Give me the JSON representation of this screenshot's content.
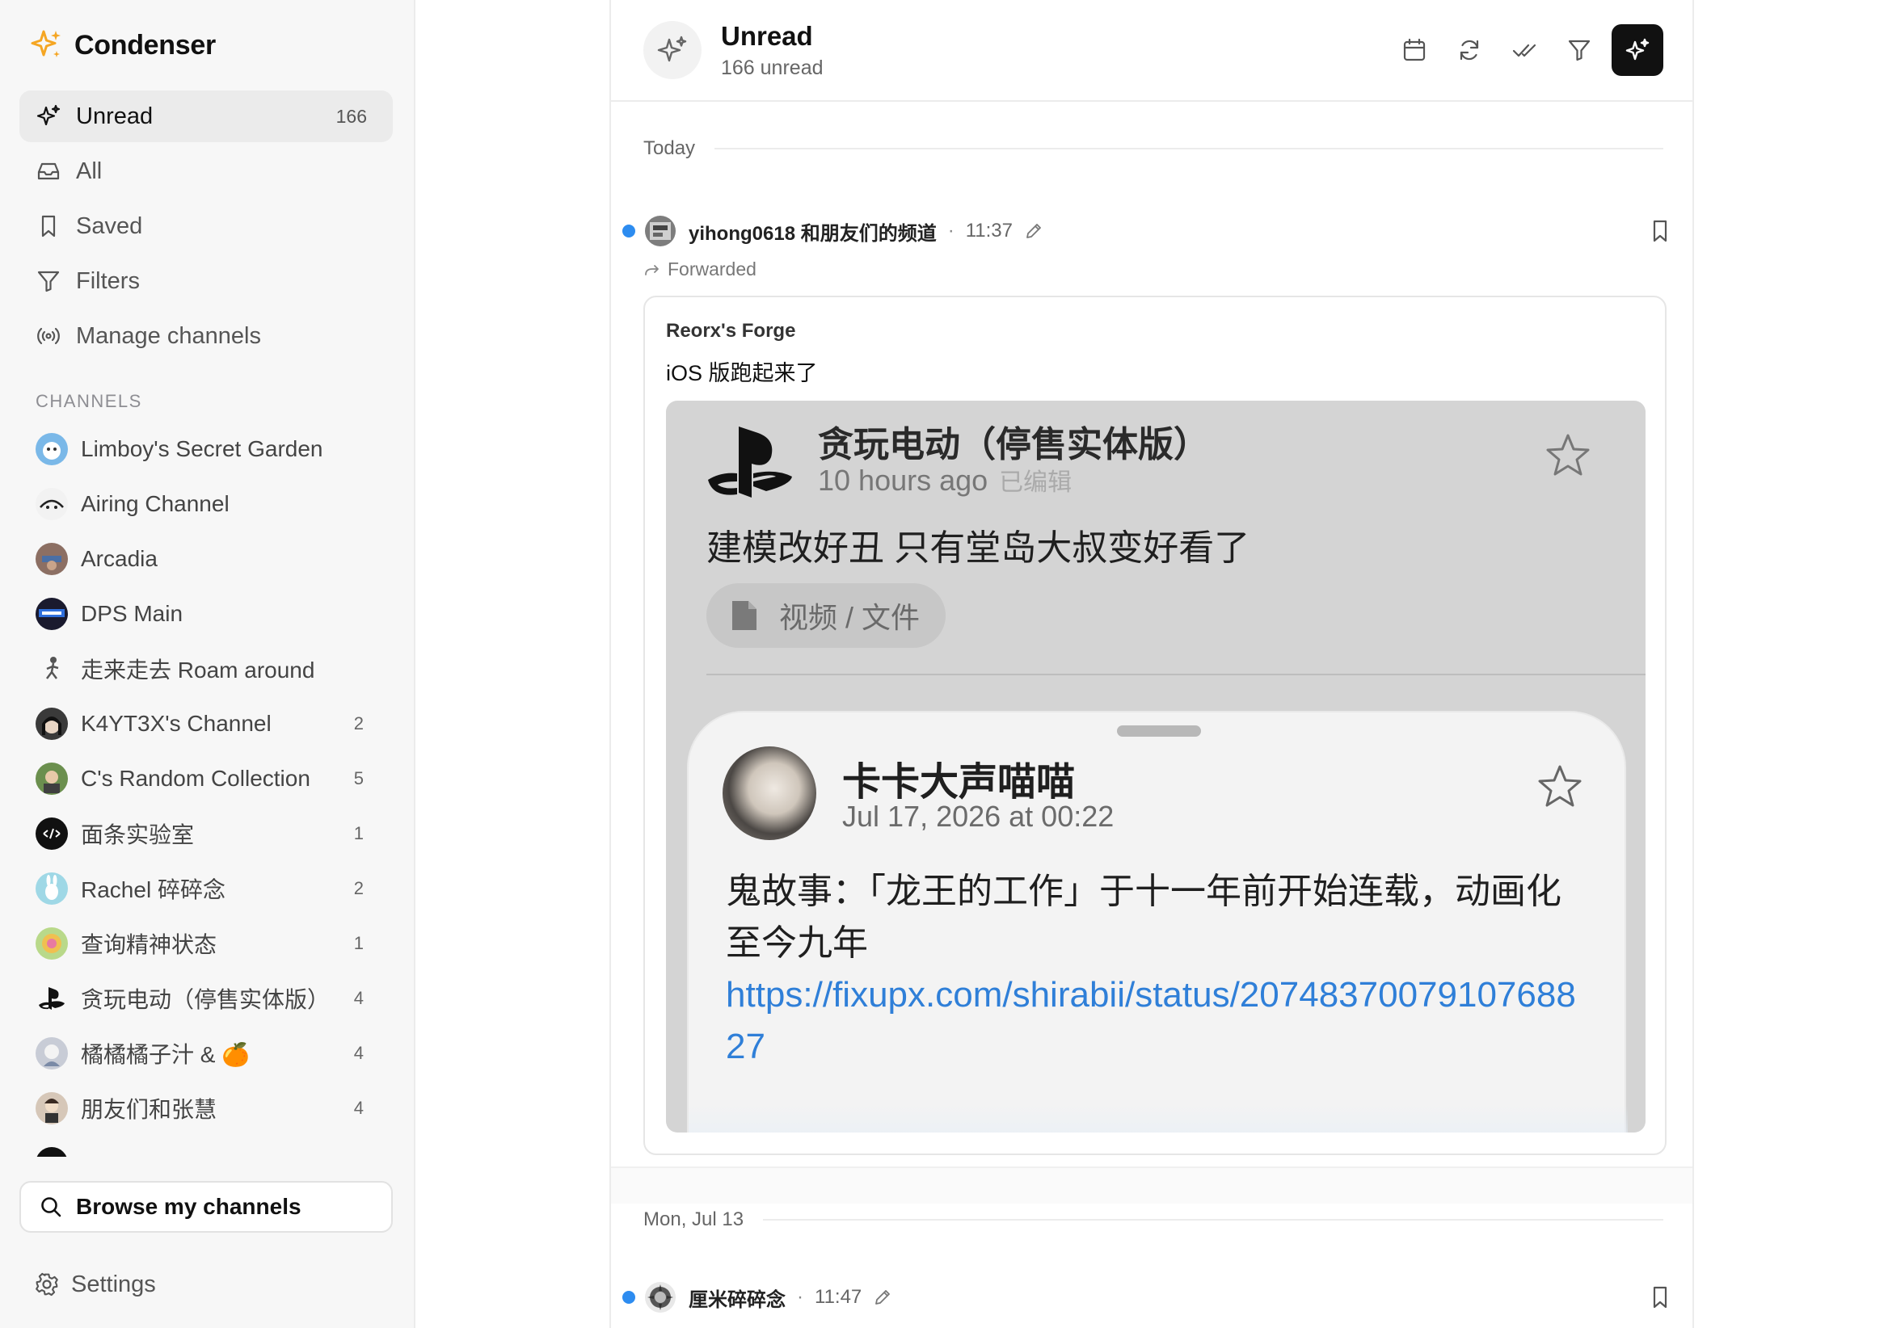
{
  "app": {
    "name": "Condenser"
  },
  "nav": [
    {
      "label": "Unread",
      "count": "166",
      "icon": "sparkle-icon",
      "active": true
    },
    {
      "label": "All",
      "count": "",
      "icon": "inbox-icon"
    },
    {
      "label": "Saved",
      "count": "",
      "icon": "bookmark-icon"
    },
    {
      "label": "Filters",
      "count": "",
      "icon": "filter-icon"
    },
    {
      "label": "Manage channels",
      "count": "",
      "icon": "broadcast-icon"
    }
  ],
  "channels_title": "CHANNELS",
  "channels": [
    {
      "name": "Limboy's Secret Garden",
      "count": "",
      "color": "#7ab8e8"
    },
    {
      "name": "Airing Channel",
      "count": "",
      "color": "#f2f2f2"
    },
    {
      "name": "Arcadia",
      "count": "",
      "color": "#8c6f63"
    },
    {
      "name": "DPS Main",
      "count": "",
      "color": "#1a1a2e"
    },
    {
      "name": "走来走去 Roam around",
      "count": "",
      "color": "#eeeeee"
    },
    {
      "name": "K4YT3X's Channel",
      "count": "2",
      "color": "#3a3a3a"
    },
    {
      "name": "C's Random Collection",
      "count": "5",
      "color": "#6b8f4e"
    },
    {
      "name": "面条实验室",
      "count": "1",
      "color": "#111111"
    },
    {
      "name": "Rachel 碎碎念",
      "count": "2",
      "color": "#9fd8e6"
    },
    {
      "name": "查询精神状态",
      "count": "1",
      "color": "#c9b46a"
    },
    {
      "name": "贪玩电动（停售实体版）",
      "count": "4",
      "color": "#ffffff"
    },
    {
      "name": "橘橘橘子汁 & 🍊",
      "count": "4",
      "color": "#c8ccd6"
    },
    {
      "name": "朋友们和张慧",
      "count": "4",
      "color": "#d6c7b8"
    },
    {
      "name": "",
      "count": "",
      "color": "#111111"
    }
  ],
  "browse_label": "Browse my channels",
  "settings_label": "Settings",
  "header": {
    "title": "Unread",
    "subtitle": "166 unread"
  },
  "sections": [
    {
      "date": "Today"
    },
    {
      "date": "Mon, Jul 13"
    }
  ],
  "messages": [
    {
      "author": "yihong0618 和朋友们的频道",
      "time": "11:37",
      "forwarded_label": "Forwarded",
      "forward_source": "Reorx's Forge",
      "text": "iOS 版跑起来了",
      "image": {
        "title": "贪玩电动（停售实体版）",
        "time": "10 hours ago",
        "edited": "已编辑",
        "body": "建模改好丑 只有堂岛大叔变好看了",
        "attachment": "视频 / 文件",
        "inner": {
          "name": "卡卡大声喵喵",
          "date": "Jul 17, 2026 at 00:22",
          "text": "鬼故事：「龙王的工作」于十一年前开始连载，动画化至今九年",
          "link": "https://fixupx.com/shirabii/status/2074837007910768827"
        }
      }
    },
    {
      "author": "厘米碎碎念",
      "time": "11:47"
    }
  ],
  "colors": {
    "accent": "#2d8cf0",
    "brand": "#f5a623",
    "primary_button": "#111111"
  }
}
